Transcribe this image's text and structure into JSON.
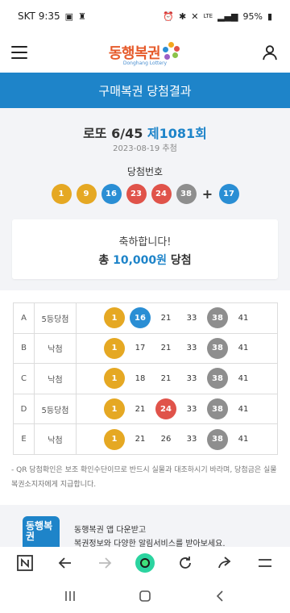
{
  "status_bar": {
    "carrier_time": "SKT 9:35",
    "battery": "95%",
    "network": "LTE"
  },
  "header": {
    "logo_text": "동행복권",
    "logo_sub": "Donghang Lottery",
    "menu_icon": "hamburger-icon",
    "account_icon": "person-icon"
  },
  "page_title": "구매복권 당첨결과",
  "summary": {
    "game_name": "로또 6/45",
    "round": "제1081회",
    "draw_date": "2023-08-19 추첨",
    "winning_label": "당첨번호",
    "winning_numbers": [
      "1",
      "9",
      "16",
      "23",
      "24",
      "38"
    ],
    "bonus_number": "17",
    "plus_sign": "+",
    "congrats": "축하합니다!",
    "total_prefix": "총",
    "total_amount": "10,000원",
    "total_suffix": "당첨"
  },
  "colors": {
    "primary": "#1e84c9",
    "ball_yellow": "#e5a823",
    "ball_blue": "#2a8ed4",
    "ball_red": "#e0534a",
    "ball_gray": "#8e8e8e"
  },
  "games": [
    {
      "letter": "A",
      "result": "5등당첨",
      "numbers": [
        "1",
        "16",
        "21",
        "33",
        "38",
        "41"
      ],
      "hits": [
        "yellow",
        "blue",
        "",
        "",
        "gray",
        ""
      ]
    },
    {
      "letter": "B",
      "result": "낙첨",
      "numbers": [
        "1",
        "17",
        "21",
        "33",
        "38",
        "41"
      ],
      "hits": [
        "yellow",
        "",
        "",
        "",
        "gray",
        ""
      ]
    },
    {
      "letter": "C",
      "result": "낙첨",
      "numbers": [
        "1",
        "18",
        "21",
        "33",
        "38",
        "41"
      ],
      "hits": [
        "yellow",
        "",
        "",
        "",
        "gray",
        ""
      ]
    },
    {
      "letter": "D",
      "result": "5등당첨",
      "numbers": [
        "1",
        "21",
        "24",
        "33",
        "38",
        "41"
      ],
      "hits": [
        "yellow",
        "",
        "red",
        "",
        "gray",
        ""
      ]
    },
    {
      "letter": "E",
      "result": "낙첨",
      "numbers": [
        "1",
        "21",
        "26",
        "33",
        "38",
        "41"
      ],
      "hits": [
        "yellow",
        "",
        "",
        "",
        "gray",
        ""
      ]
    }
  ],
  "notice": "- QR 당첨확인은 보조 확인수단이므로 반드시 실물과 대조하시기 바라며, 당첨금은 실물 복권소지자에게 지급합니다.",
  "promo": {
    "icon_text": "동행복권",
    "line1": "동행복권 앱 다운받고",
    "line2": "복권정보와 다양한 알림서비스를 받아보세요."
  },
  "browser_bar": {
    "icons": [
      "naver-n-icon",
      "back-arrow-icon",
      "forward-arrow-icon",
      "home-green-icon",
      "reload-icon",
      "share-icon",
      "menu-lines-icon"
    ]
  },
  "nav_bar": {
    "icons": [
      "recent-apps-icon",
      "home-icon",
      "back-icon"
    ]
  }
}
